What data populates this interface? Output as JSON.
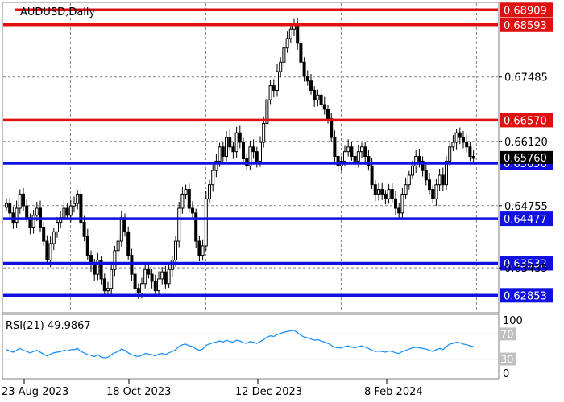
{
  "chart_data": {
    "type": "candlestick",
    "title": "AUDUSD,Daily",
    "ylim": [
      0.625,
      0.6905
    ],
    "price_ticks": [
      "0.67485",
      "0.66120",
      "0.64755",
      "0.63435"
    ],
    "current_price": "0.65760",
    "x_labels": [
      {
        "label": "23 Aug 2023",
        "index": 7
      },
      {
        "label": "18 Oct 2023",
        "index": 47
      },
      {
        "label": "12 Dec 2023",
        "index": 87
      },
      {
        "label": "8 Feb 2024",
        "index": 127
      }
    ],
    "levels": [
      {
        "value": "0.68909",
        "color": "#e01010"
      },
      {
        "value": "0.68593",
        "color": "#e01010"
      },
      {
        "value": "0.66570",
        "color": "#e01010"
      },
      {
        "value": "0.65656",
        "color": "#1010e0"
      },
      {
        "value": "0.64477",
        "color": "#1010e0"
      },
      {
        "value": "0.63532",
        "color": "#1010e0"
      },
      {
        "value": "0.62853",
        "color": "#1010e0"
      }
    ],
    "candles_close": [
      0.648,
      0.646,
      0.644,
      0.647,
      0.65,
      0.6475,
      0.645,
      0.643,
      0.6455,
      0.647,
      0.643,
      0.64,
      0.636,
      0.6395,
      0.642,
      0.644,
      0.645,
      0.647,
      0.6455,
      0.6475,
      0.648,
      0.65,
      0.644,
      0.641,
      0.637,
      0.635,
      0.633,
      0.636,
      0.632,
      0.6295,
      0.63,
      0.634,
      0.638,
      0.64,
      0.645,
      0.642,
      0.637,
      0.633,
      0.63,
      0.629,
      0.631,
      0.634,
      0.633,
      0.6315,
      0.6295,
      0.632,
      0.6335,
      0.631,
      0.634,
      0.636,
      0.64,
      0.647,
      0.65,
      0.651,
      0.647,
      0.646,
      0.64,
      0.637,
      0.639,
      0.649,
      0.652,
      0.655,
      0.657,
      0.66,
      0.658,
      0.662,
      0.66,
      0.659,
      0.663,
      0.661,
      0.6575,
      0.656,
      0.66,
      0.659,
      0.657,
      0.661,
      0.665,
      0.67,
      0.673,
      0.672,
      0.676,
      0.678,
      0.681,
      0.683,
      0.685,
      0.686,
      0.682,
      0.678,
      0.675,
      0.674,
      0.672,
      0.67,
      0.671,
      0.669,
      0.668,
      0.666,
      0.662,
      0.658,
      0.656,
      0.657,
      0.659,
      0.66,
      0.658,
      0.657,
      0.659,
      0.66,
      0.658,
      0.656,
      0.652,
      0.65,
      0.651,
      0.65,
      0.649,
      0.651,
      0.649,
      0.647,
      0.646,
      0.65,
      0.652,
      0.654,
      0.656,
      0.658,
      0.657,
      0.655,
      0.653,
      0.651,
      0.649,
      0.652,
      0.654,
      0.652,
      0.657,
      0.66,
      0.661,
      0.663,
      0.662,
      0.661,
      0.66,
      0.658,
      0.6576
    ],
    "rsi": {
      "label": "RSI(21) 49.9867",
      "ylim": [
        0,
        100
      ],
      "axis_ticks": [
        "100",
        "0"
      ],
      "levels": [
        "70",
        "30"
      ],
      "values": [
        45,
        43,
        41,
        44,
        47,
        44,
        42,
        40,
        42,
        44,
        41,
        38,
        35,
        38,
        40,
        41,
        42,
        44,
        43,
        45,
        45,
        47,
        42,
        40,
        37,
        36,
        34,
        37,
        33,
        32,
        33,
        37,
        40,
        42,
        46,
        44,
        40,
        37,
        35,
        34,
        36,
        39,
        38,
        37,
        35,
        38,
        39,
        37,
        40,
        42,
        45,
        50,
        53,
        54,
        51,
        50,
        46,
        44,
        46,
        52,
        54,
        56,
        57,
        59,
        57,
        60,
        58,
        57,
        60,
        59,
        56,
        55,
        58,
        57,
        55,
        58,
        61,
        65,
        67,
        66,
        69,
        71,
        73,
        74,
        75,
        76,
        72,
        68,
        65,
        64,
        62,
        60,
        61,
        59,
        57,
        55,
        52,
        49,
        48,
        48,
        50,
        51,
        49,
        48,
        50,
        51,
        49,
        47,
        44,
        42,
        43,
        42,
        41,
        43,
        42,
        40,
        39,
        42,
        44,
        46,
        48,
        49,
        48,
        47,
        46,
        44,
        42,
        45,
        47,
        45,
        50,
        54,
        55,
        57,
        56,
        54,
        53,
        51,
        50
      ]
    }
  },
  "colors": {
    "bull": "#ffffff",
    "bear": "#000000",
    "wick": "#000000",
    "rsi_line": "#1e90ff",
    "rsi_band": "#c0c0c0",
    "price_tag_bg": "#000000",
    "grid": "#808080"
  }
}
